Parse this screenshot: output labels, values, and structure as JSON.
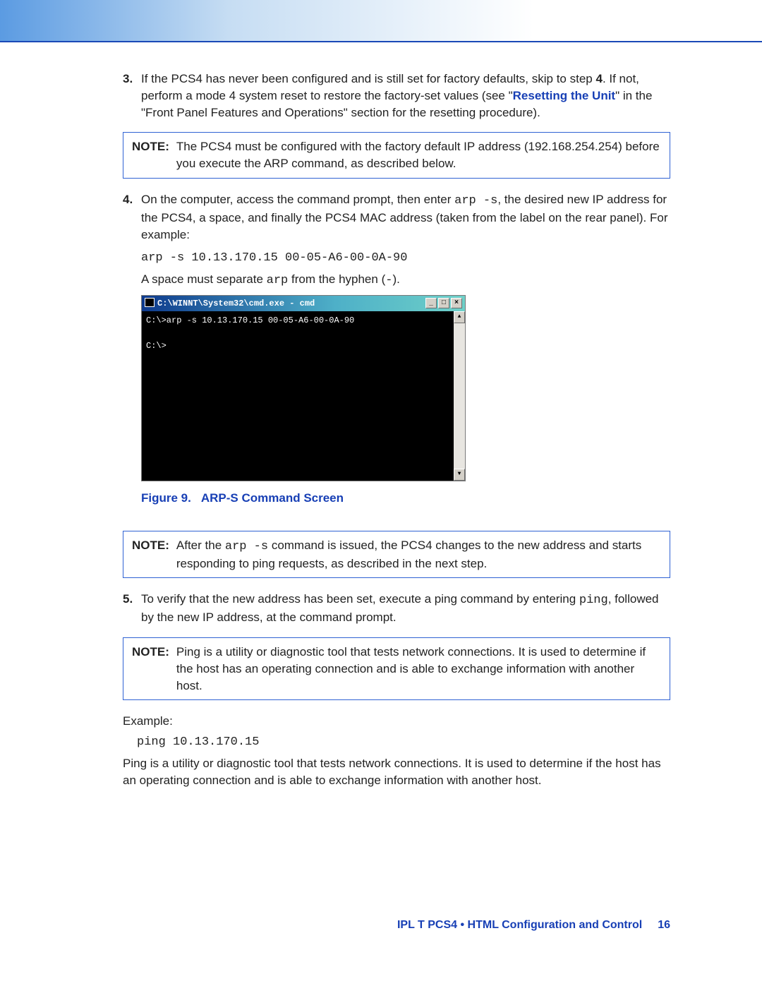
{
  "steps": {
    "s3": {
      "num": "3.",
      "t1": "If the PCS4 has never been configured and is still set for factory defaults, skip to step ",
      "step4": "4",
      "t2": ". If not, perform a mode 4 system reset to restore the factory-set values (see \"",
      "link": "Resetting the Unit",
      "t3": "\" in the \"Front Panel Features and Operations\" section for the resetting procedure)."
    },
    "note_a": {
      "label": "NOTE:",
      "text": "The PCS4 must be configured with the factory default IP address (192.168.254.254) before you execute the ARP command, as described below."
    },
    "s4": {
      "num": "4.",
      "t1": "On the computer, access the command prompt, then enter ",
      "code1": "arp -s",
      "t2": ", the desired new IP address for the PCS4, a space, and finally the PCS4 MAC address (taken from the label on the rear panel). For example:",
      "cmd": "arp -s 10.13.170.15 00-05-A6-00-0A-90",
      "t3a": "A space must separate ",
      "code2": "arp",
      "t3b": " from the hyphen (",
      "code3": "-",
      "t3c": ")."
    },
    "console": {
      "title": "C:\\WINNT\\System32\\cmd.exe - cmd",
      "line1": "C:\\>arp -s 10.13.170.15 00-05-A6-00-0A-90",
      "line2": "C:\\>"
    },
    "fig": {
      "ref": "Figure 9.",
      "cap": "ARP-S Command Screen"
    },
    "note_b": {
      "label": "NOTE:",
      "t1": "After the ",
      "code": "arp -s",
      "t2": " command is issued, the PCS4 changes to the new address and starts responding to ping requests, as described in the next step."
    },
    "s5": {
      "num": "5.",
      "t1": "To verify that the new address has been set, execute a ping command by entering ",
      "code1": "ping",
      "t2": ", followed by the new IP address, at the command prompt."
    },
    "note_c": {
      "label": "NOTE:",
      "text": "Ping is a utility or diagnostic tool that tests network connections. It is used to determine if the host has an operating connection and is able to exchange information with another host."
    },
    "example": {
      "label": "Example:",
      "cmd": "ping 10.13.170.15",
      "desc": "Ping is a utility or diagnostic tool that tests network connections. It is used to determine if the host has an operating connection and is able to exchange information with another host."
    }
  },
  "footer": {
    "text": "IPL T PCS4 • HTML Configuration and Control",
    "pagenum": "16"
  },
  "winbuttons": {
    "min": "_",
    "max": "□",
    "close": "×",
    "up": "▲",
    "down": "▼"
  }
}
